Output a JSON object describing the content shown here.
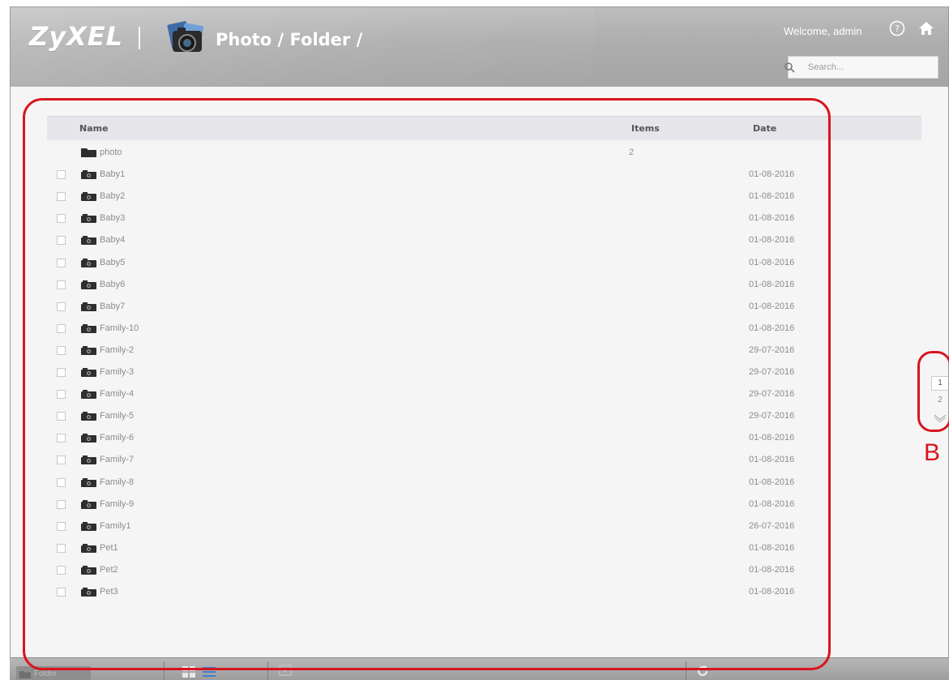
{
  "header": {
    "logo_text": "ZyXEL",
    "breadcrumb": "Photo / Folder /",
    "welcome": "Welcome, admin",
    "search_placeholder": "Search...",
    "icons": [
      "photo-app-icon",
      "help-icon",
      "home-icon",
      "search-icon"
    ]
  },
  "table": {
    "columns": {
      "name": "Name",
      "items": "Items",
      "date": "Date"
    },
    "rows": [
      {
        "name": "photo",
        "items": "2",
        "date": "",
        "type": "folder"
      },
      {
        "name": "Baby1",
        "items": "",
        "date": "01-08-2016",
        "type": "album"
      },
      {
        "name": "Baby2",
        "items": "",
        "date": "01-08-2016",
        "type": "album"
      },
      {
        "name": "Baby3",
        "items": "",
        "date": "01-08-2016",
        "type": "album"
      },
      {
        "name": "Baby4",
        "items": "",
        "date": "01-08-2016",
        "type": "album"
      },
      {
        "name": "Baby5",
        "items": "",
        "date": "01-08-2016",
        "type": "album"
      },
      {
        "name": "Baby6",
        "items": "",
        "date": "01-08-2016",
        "type": "album"
      },
      {
        "name": "Baby7",
        "items": "",
        "date": "01-08-2016",
        "type": "album"
      },
      {
        "name": "Family-10",
        "items": "",
        "date": "01-08-2016",
        "type": "album"
      },
      {
        "name": "Family-2",
        "items": "",
        "date": "29-07-2016",
        "type": "album"
      },
      {
        "name": "Family-3",
        "items": "",
        "date": "29-07-2016",
        "type": "album"
      },
      {
        "name": "Family-4",
        "items": "",
        "date": "29-07-2016",
        "type": "album"
      },
      {
        "name": "Family-5",
        "items": "",
        "date": "29-07-2016",
        "type": "album"
      },
      {
        "name": "Family-6",
        "items": "",
        "date": "01-08-2016",
        "type": "album"
      },
      {
        "name": "Family-7",
        "items": "",
        "date": "01-08-2016",
        "type": "album"
      },
      {
        "name": "Family-8",
        "items": "",
        "date": "01-08-2016",
        "type": "album"
      },
      {
        "name": "Family-9",
        "items": "",
        "date": "01-08-2016",
        "type": "album"
      },
      {
        "name": "Family1",
        "items": "",
        "date": "26-07-2016",
        "type": "album"
      },
      {
        "name": "Pet1",
        "items": "",
        "date": "01-08-2016",
        "type": "album"
      },
      {
        "name": "Pet2",
        "items": "",
        "date": "01-08-2016",
        "type": "album"
      },
      {
        "name": "Pet3",
        "items": "",
        "date": "01-08-2016",
        "type": "album"
      }
    ]
  },
  "pagination": {
    "pages": [
      "1",
      "2"
    ],
    "current": "1"
  },
  "annotation": {
    "label": "B"
  },
  "bottombar": {
    "folder_label": "Folder",
    "icons": [
      "folder-icon",
      "grid-view-icon",
      "list-view-icon",
      "slideshow-icon",
      "refresh-icon"
    ]
  },
  "colors": {
    "annotation": "#d8151f",
    "header": "#adadad",
    "table_header": "#e5e5ea"
  }
}
